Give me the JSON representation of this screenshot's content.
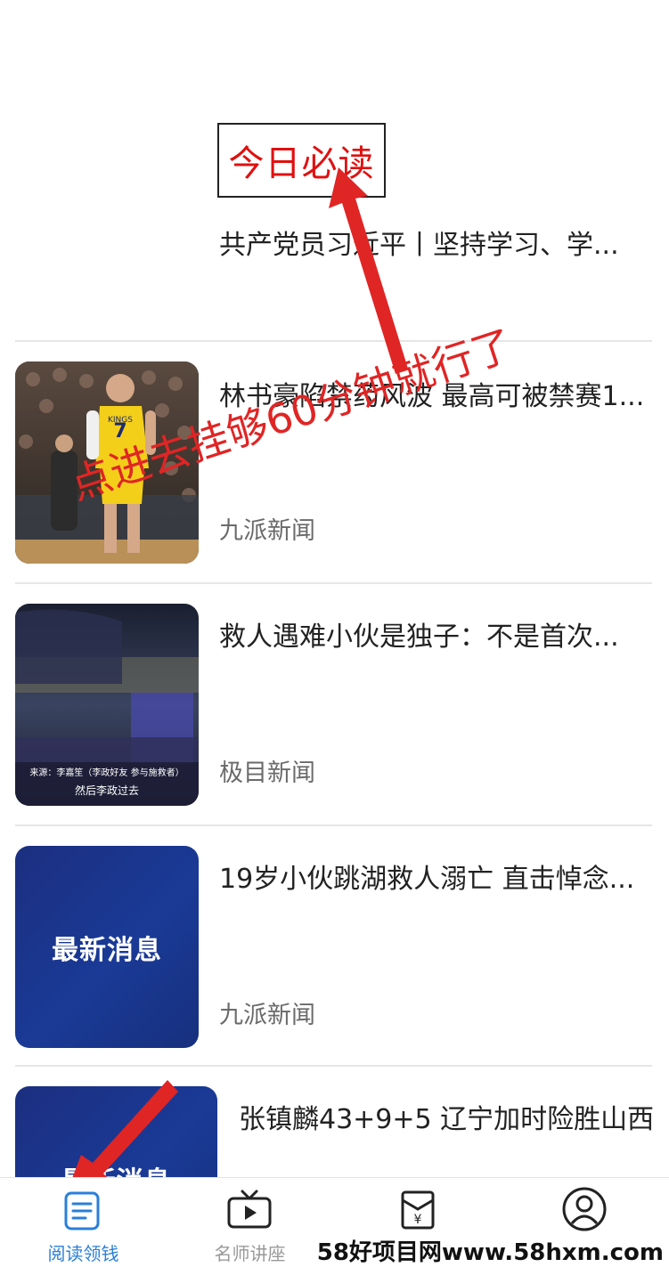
{
  "featured": {
    "label": "今日必读",
    "title": "共产党员习近平丨坚持学习、学..."
  },
  "news": [
    {
      "title": "林书豪陷禁药风波 最高可被禁赛1...",
      "source": "九派新闻"
    },
    {
      "title": "救人遇难小伙是独子：不是首次...",
      "source": "极目新闻",
      "caption_line1": "来源：李嘉笙（李政好友 参与施救者）",
      "caption_line2": "然后李政过去"
    },
    {
      "title": "19岁小伙跳湖救人溺亡 直击悼念...",
      "source": "九派新闻",
      "tile_text": "最新消息"
    },
    {
      "title": "张镇麟43+9+5 辽宁加时险胜山西",
      "tile_text": "最新消息"
    }
  ],
  "jersey": {
    "brand": "KINGS",
    "number": "7"
  },
  "annotation": {
    "text": "点进去挂够60分钟就行了"
  },
  "tabs": [
    {
      "label": "阅读领钱",
      "icon": "document-icon",
      "active": true
    },
    {
      "label": "名师讲座",
      "icon": "tv-play-icon",
      "active": false
    },
    {
      "label": "",
      "icon": "red-envelope-icon",
      "active": false
    },
    {
      "label": "",
      "icon": "user-icon",
      "active": false
    }
  ],
  "watermark": {
    "text": "58好项目网www.58hxm.com"
  },
  "colors": {
    "accent": "#2a7fd8",
    "annotation": "#e02525",
    "tile_blue": "#1a3a96"
  }
}
